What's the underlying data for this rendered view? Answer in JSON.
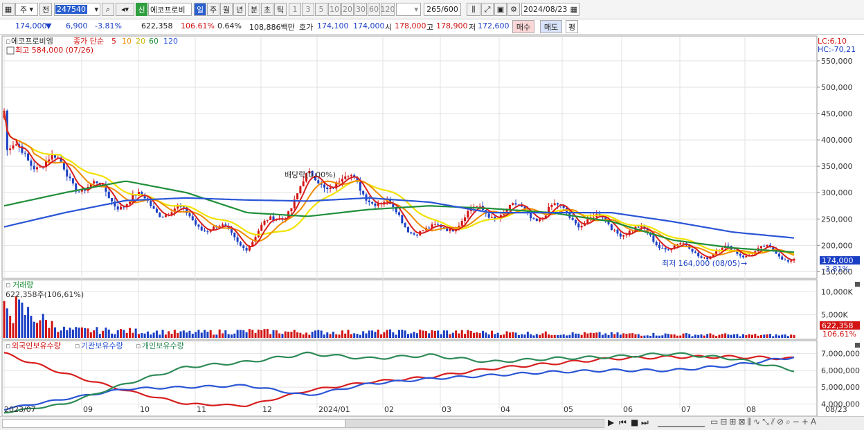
{
  "toolbar": {
    "market": "주",
    "prev": "전",
    "code": "247540",
    "name": "에코프로비",
    "new_badge": "신",
    "periods": [
      "일",
      "주",
      "월",
      "년",
      "분",
      "초",
      "틱"
    ],
    "minutes": [
      "1",
      "3",
      "5",
      "10",
      "20",
      "30",
      "60",
      "120"
    ],
    "count": "265",
    "count_max": "/600",
    "date": "2024/08/23"
  },
  "info": {
    "price": "174,000",
    "arrow": "▼",
    "change": "6,900",
    "change_pct": "-3.81%",
    "volume": "622,358",
    "vol_ratio": "106.61%",
    "turnover_rate": "0.64%",
    "amount": "108,886백만",
    "ask_label": "호가",
    "ask": "174,100",
    "bid": "174,000",
    "open_label": "시",
    "open": "178,000",
    "high_label": "고",
    "high": "178,900",
    "low_label": "저",
    "low": "172,600",
    "buy": "매수",
    "sell": "매도",
    "avg": "평"
  },
  "price_panel": {
    "legend_name": "에코프로비엠",
    "legend_item": "종가 단순",
    "ma_periods": [
      "5",
      "10",
      "20",
      "60",
      "120"
    ],
    "ma_colors": [
      "#d81e1e",
      "#f08c00",
      "#f2e200",
      "#1f8f3a",
      "#2a55d6"
    ],
    "max_label": "최고 584,000 (07/26)",
    "min_label": "최저 164,000 (08/05)",
    "event_label": "배당락(0,00%)",
    "lc": "LC:6,10",
    "hc": "HC:-70,21",
    "price_tag": "174,000",
    "pct_tag": "-3,81%",
    "y_ticks": [
      "550,000",
      "500,000",
      "450,000",
      "400,000",
      "350,000",
      "300,000",
      "250,000",
      "200,000",
      "150,000"
    ]
  },
  "volume_panel": {
    "title": "거래량",
    "value_label": "622,358주(106,61%)",
    "y_ticks": [
      "10,000K",
      "5,000K"
    ],
    "vol_tag": "622,358",
    "vol_pct": "106,61%"
  },
  "holding_panel": {
    "series": [
      "외국인보유수량",
      "기관보유수량",
      "개인보유수량"
    ],
    "colors": [
      "#d81e1e",
      "#2a55d6",
      "#2e8b57"
    ],
    "y_ticks": [
      "7,000,000",
      "6,000,000",
      "5,000,000",
      "4,000,000"
    ]
  },
  "x_axis": [
    "2023/07",
    "09",
    "10",
    "11",
    "12",
    "2024/01",
    "02",
    "03",
    "04",
    "05",
    "06",
    "07",
    "08",
    "08/23"
  ],
  "chart_data": {
    "type": "candlestick",
    "title": "에코프로비엠",
    "dates": [
      "2023-07",
      "2023-08",
      "2023-09",
      "2023-10",
      "2023-11",
      "2023-12",
      "2024-01",
      "2024-02",
      "2024-03",
      "2024-04",
      "2024-05",
      "2024-06",
      "2024-07",
      "2024-08"
    ],
    "close": [
      370000,
      330000,
      300000,
      240000,
      215000,
      310000,
      305000,
      225000,
      255000,
      280000,
      225000,
      205000,
      185000,
      174000
    ],
    "ma60": [
      275000,
      300000,
      322000,
      300000,
      262000,
      255000,
      268000,
      275000,
      270000,
      262000,
      245000,
      210000,
      195000,
      187000
    ],
    "ma120": [
      235000,
      262000,
      285000,
      290000,
      286000,
      284000,
      290000,
      282000,
      262000,
      262000,
      262000,
      245000,
      225000,
      214000
    ],
    "ylim": [
      150000,
      584000
    ],
    "max": {
      "value": 584000,
      "date": "07/26"
    },
    "min": {
      "value": 164000,
      "date": "08/05"
    },
    "volume_K": [
      8000,
      1800,
      1600,
      1200,
      1500,
      1300,
      1300,
      1400,
      1200,
      1000,
      900,
      800,
      700,
      622
    ],
    "holdings": {
      "foreign": [
        7000000,
        5800000,
        4800000,
        4000000,
        3900000,
        4800000,
        5300000,
        5600000,
        6100000,
        6400000,
        6700000,
        6800000,
        6800000,
        6700000
      ],
      "institution": [
        3700000,
        4300000,
        4900000,
        5000000,
        5100000,
        4500000,
        5200000,
        5500000,
        5700000,
        5900000,
        6000000,
        6000000,
        6300000,
        6800000
      ],
      "individual": [
        3500000,
        4000000,
        5200000,
        6200000,
        6500000,
        7000000,
        6700000,
        6900000,
        6500000,
        6700000,
        6800000,
        7000000,
        6700000,
        6000000
      ]
    }
  }
}
